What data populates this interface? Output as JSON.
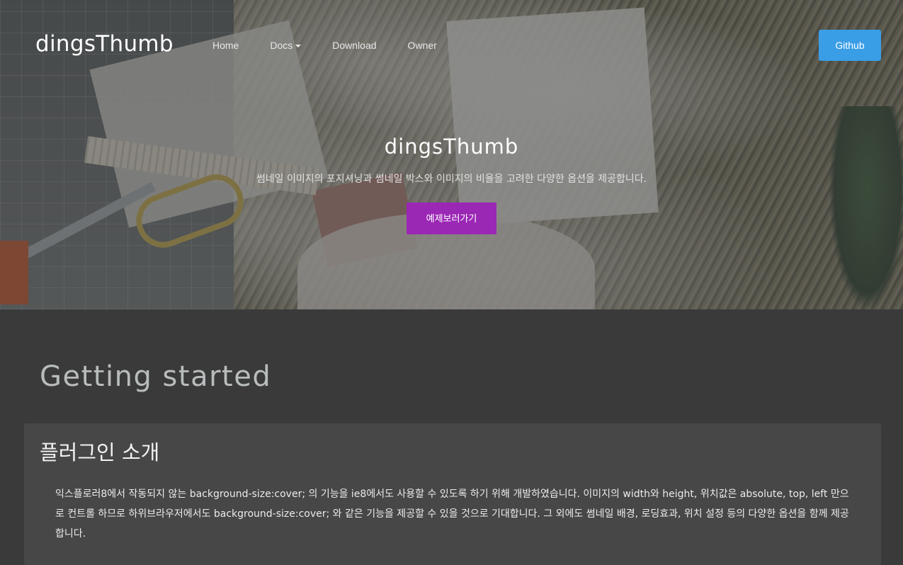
{
  "nav": {
    "brand": "dingsThumb",
    "links": [
      {
        "label": "Home"
      },
      {
        "label": "Docs"
      },
      {
        "label": "Download"
      },
      {
        "label": "Owner"
      }
    ],
    "github_label": "Github"
  },
  "hero": {
    "title": "dingsThumb",
    "subtitle": "썸네일 이미지의 포지셔닝과 썸네일 박스와 이미지의 비율을 고려한 다양한 옵션을 제공합니다.",
    "button_label": "예제보러가기",
    "button_color": "#9b27b5"
  },
  "main": {
    "section_title": "Getting started",
    "card": {
      "title": "플러그인 소개",
      "body": "익스플로러8에서 작동되지 않는 background-size:cover; 의 기능을 ie8에서도 사용할 수 있도록 하기 위해 개발하였습니다. 이미지의 width와 height, 위치값은 absolute, top, left 만으로 컨트롤 하므로 하위브라우저에서도 background-size:cover; 와 같은 기능을 제공할 수 있을 것으로 기대합니다. 그 외에도 썸네일 배경, 로딩효과, 위치 설정 등의 다양한 옵션을 함께 제공합니다."
    }
  },
  "colors": {
    "github_button": "#3a9ee6",
    "page_background": "#3a3a3a",
    "card_background": "#474747"
  },
  "icons": {
    "docs_dropdown": "caret-down-icon"
  }
}
